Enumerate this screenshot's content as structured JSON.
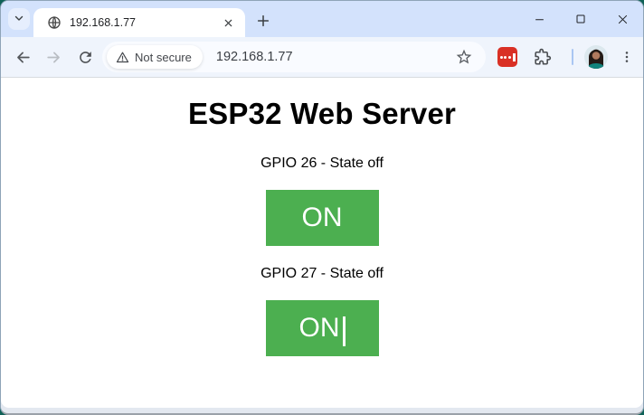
{
  "theme": {
    "desktop_bg": "#0e6157",
    "tab_strip_bg": "#d3e2fc",
    "toolbar_bg": "#eff4fc",
    "button_green": "#4CAF50",
    "lastpass_red": "#d93025"
  },
  "browser": {
    "tab": {
      "title": "192.168.1.77"
    },
    "address_bar": {
      "security_chip": "Not secure",
      "url": "192.168.1.77"
    },
    "icons": {
      "tab_search": "chevron-down",
      "favicon": "globe",
      "tab_close": "x",
      "new_tab": "plus",
      "minimize": "horizontal-line",
      "maximize": "square-outline",
      "close_window": "x",
      "back": "arrow-left",
      "forward": "arrow-right",
      "reload": "circular-arrow",
      "security_warning": "warning-triangle",
      "bookmark": "star-outline",
      "password_manager": "lastpass-dots-and-bar",
      "extensions": "puzzle-piece",
      "profile": "user-avatar-photo",
      "menu": "three-dots-vertical"
    }
  },
  "page": {
    "title": "ESP32 Web Server",
    "sections": [
      {
        "label": "GPIO 26 - State off",
        "button_label": "ON"
      },
      {
        "label": "GPIO 27 - State off",
        "button_label": "ON"
      }
    ]
  }
}
